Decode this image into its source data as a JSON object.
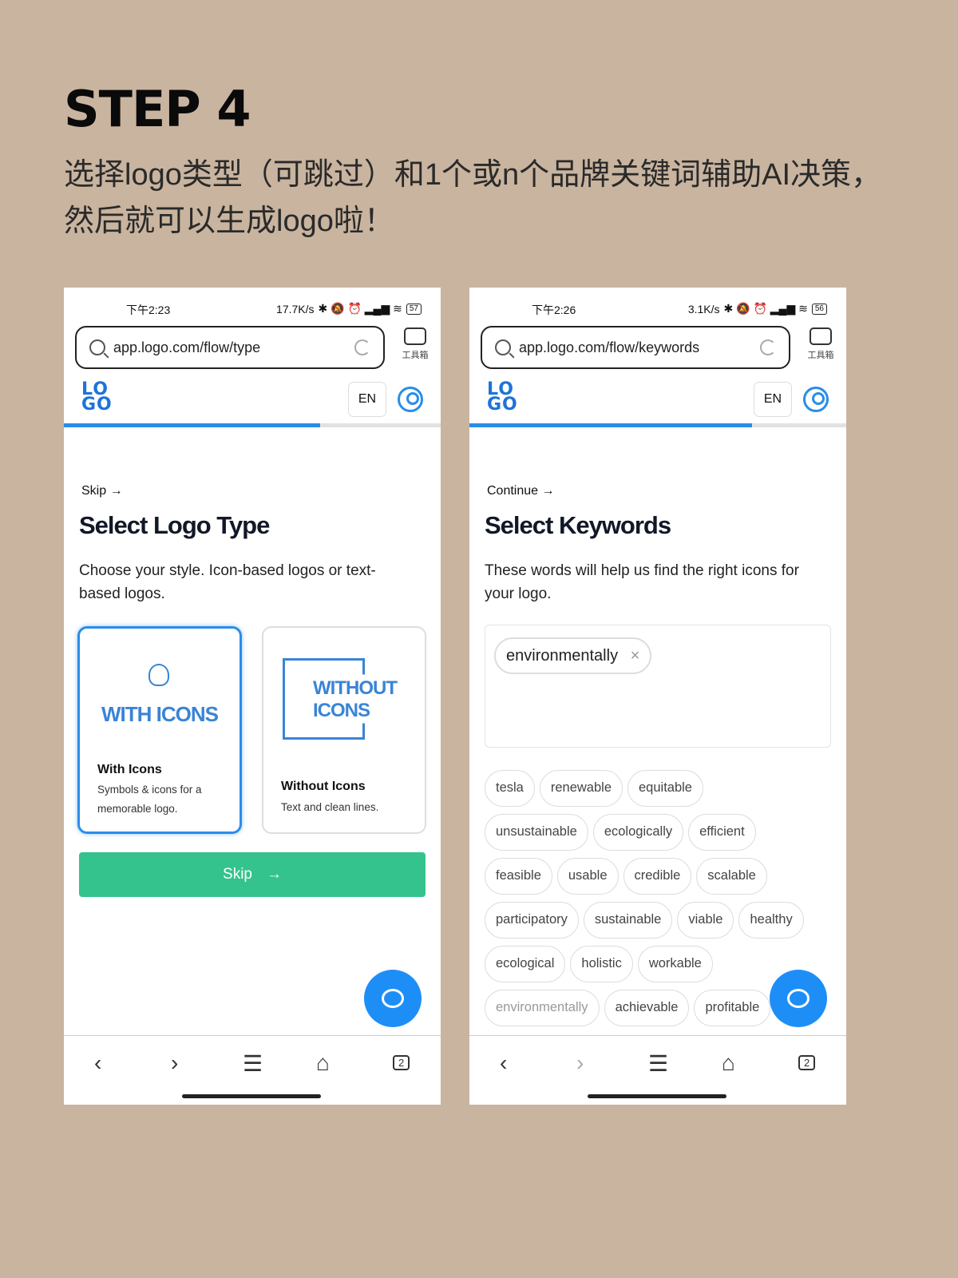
{
  "heading": "STEP 4",
  "subtitle": "选择logo类型（可跳过）和1个或n个品牌关键词辅助AI决策，然后就可以生成logo啦！",
  "colors": {
    "accent": "#2a8de8",
    "primary_button": "#34c38c",
    "background": "#c9b49f"
  },
  "phone1": {
    "status": {
      "time": "下午2:23",
      "speed": "17.7K/s",
      "battery": "57"
    },
    "url": "app.logo.com/flow/type",
    "toolbox": "工具箱",
    "logo": "LOGO",
    "lang": "EN",
    "progress_percent": 68,
    "link": "Skip →",
    "title": "Select Logo Type",
    "desc": "Choose your style. Icon-based logos or text-based logos.",
    "cards": [
      {
        "art": "WITH ICONS",
        "title": "With Icons",
        "desc": "Symbols & icons for a memorable logo.",
        "selected": true
      },
      {
        "art": "WITHOUT ICONS",
        "title": "Without Icons",
        "desc": "Text and clean lines.",
        "selected": false
      }
    ],
    "button": "Skip",
    "tabs_count": "2"
  },
  "phone2": {
    "status": {
      "time": "下午2:26",
      "speed": "3.1K/s",
      "battery": "56"
    },
    "url": "app.logo.com/flow/keywords",
    "toolbox": "工具箱",
    "logo": "LOGO",
    "lang": "EN",
    "progress_percent": 75,
    "link": "Continue →",
    "title": "Select Keywords",
    "desc": "These words will help us find the right icons for your logo.",
    "selected_keyword": "environmentally",
    "keywords": [
      "tesla",
      "renewable",
      "equitable",
      "unsustainable",
      "ecologically",
      "efficient",
      "feasible",
      "usable",
      "credible",
      "scalable",
      "participatory",
      "sustainable",
      "viable",
      "healthy",
      "ecological",
      "holistic",
      "workable",
      "environmentally",
      "achievable",
      "profitable"
    ],
    "tabs_count": "2"
  }
}
